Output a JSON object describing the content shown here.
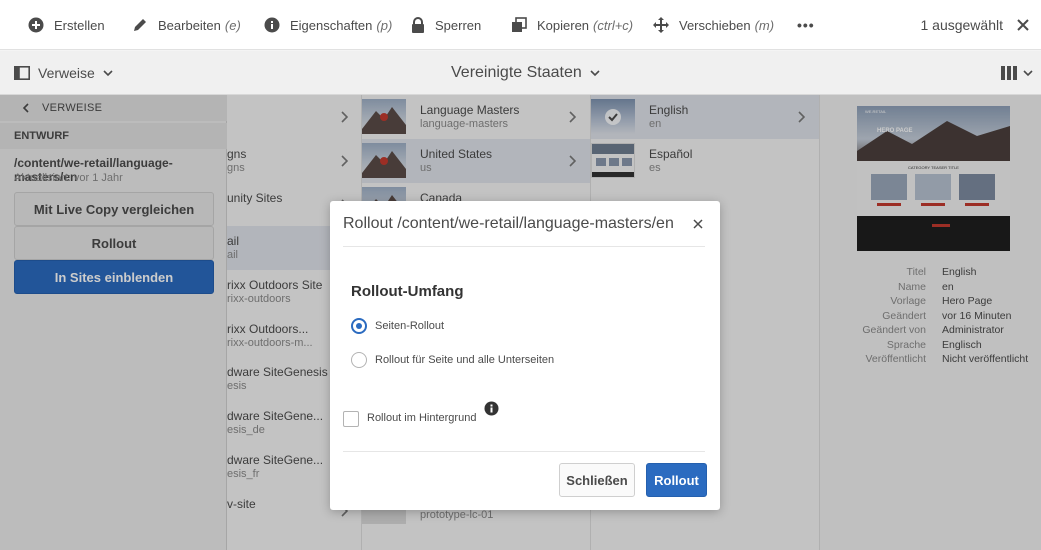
{
  "toolbar": {
    "create": "Erstellen",
    "edit": "Bearbeiten",
    "edit_hint": "(e)",
    "properties": "Eigenschaften",
    "properties_hint": "(p)",
    "lock": "Sperren",
    "copy": "Kopieren",
    "copy_hint": "(ctrl+c)",
    "move": "Verschieben",
    "move_hint": "(m)",
    "more": "•••",
    "selection_count": "1 ausgewählt"
  },
  "subbar": {
    "rail_label": "Verweise",
    "title": "Vereinigte Staaten"
  },
  "rail": {
    "back_label": "VERWEISE",
    "section": "ENTWURF",
    "path": "/content/we-retail/language-masters/en",
    "updated": "Aktualisiert: vor 1 Jahr",
    "compare_btn": "Mit Live Copy vergleichen",
    "rollout_btn": "Rollout",
    "show_btn": "In Sites einblenden"
  },
  "col1": {
    "rows": [
      {
        "title": "gns",
        "sub": "gns"
      },
      {
        "title": "unity Sites",
        "sub": ""
      },
      {
        "title": "ail",
        "sub": "ail"
      },
      {
        "title": "rixx Outdoors Site",
        "sub": "rixx-outdoors"
      },
      {
        "title": "rixx Outdoors...",
        "sub": "rixx-outdoors-m..."
      },
      {
        "title": "dware SiteGenesis",
        "sub": "esis"
      },
      {
        "title": "dware SiteGene...",
        "sub": "esis_de"
      },
      {
        "title": "dware SiteGene...",
        "sub": "esis_fr"
      },
      {
        "title": "v-site",
        "sub": ""
      }
    ]
  },
  "col2": {
    "rows": [
      {
        "title": "Language Masters",
        "sub": "language-masters"
      },
      {
        "title": "United States",
        "sub": "us"
      },
      {
        "title": "Canada",
        "sub": ""
      },
      {
        "title": "",
        "sub": "prototype-lc-01"
      }
    ]
  },
  "col3": {
    "rows": [
      {
        "title": "English",
        "sub": "en"
      },
      {
        "title": "Español",
        "sub": "es"
      }
    ]
  },
  "preview": {
    "hero_text": "HERO PAGE",
    "section_text": "CATEGORY TEASER TITLE",
    "brand": "WE.RETAIL"
  },
  "meta": {
    "keys": [
      "Titel",
      "Name",
      "Vorlage",
      "Geändert",
      "Geändert von",
      "Sprache",
      "Veröffentlicht"
    ],
    "values": [
      "English",
      "en",
      "Hero Page",
      "vor 16 Minuten",
      "Administrator",
      "Englisch",
      "Nicht veröffentlicht"
    ]
  },
  "dialog": {
    "title": "Rollout /content/we-retail/language-masters/en",
    "heading": "Rollout-Umfang",
    "option1": "Seiten-Rollout",
    "option1_checked": true,
    "option2": "Rollout für Seite und alle Unterseiten",
    "option2_checked": false,
    "background_label": "Rollout im Hintergrund",
    "background_checked": false,
    "close_btn": "Schließen",
    "rollout_btn": "Rollout"
  },
  "colors": {
    "primary": "#2b6bc0",
    "selected_row": "#dfe3ea"
  }
}
